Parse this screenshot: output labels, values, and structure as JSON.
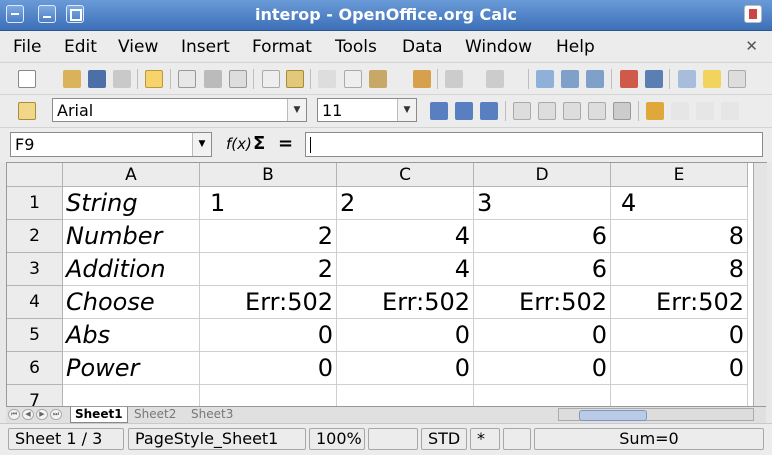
{
  "window": {
    "title": "interop - OpenOffice.org Calc"
  },
  "menu": [
    "File",
    "Edit",
    "View",
    "Insert",
    "Format",
    "Tools",
    "Data",
    "Window",
    "Help"
  ],
  "format_toolbar": {
    "font_name": "Arial",
    "font_size": "11"
  },
  "formula_bar": {
    "cell_ref": "F9",
    "fx_label": "f(x)",
    "sum_label": "Σ",
    "equals_label": "=",
    "content": ""
  },
  "columns": [
    "A",
    "B",
    "C",
    "D",
    "E"
  ],
  "rows": [
    {
      "num": "1",
      "cells": [
        "String",
        "1",
        "2",
        "3",
        "4"
      ]
    },
    {
      "num": "2",
      "cells": [
        "Number",
        "2",
        "4",
        "6",
        "8"
      ]
    },
    {
      "num": "3",
      "cells": [
        "Addition",
        "2",
        "4",
        "6",
        "8"
      ]
    },
    {
      "num": "4",
      "cells": [
        "Choose",
        "Err:502",
        "Err:502",
        "Err:502",
        "Err:502"
      ]
    },
    {
      "num": "5",
      "cells": [
        "Abs",
        "0",
        "0",
        "0",
        "0"
      ]
    },
    {
      "num": "6",
      "cells": [
        "Power",
        "0",
        "0",
        "0",
        "0"
      ]
    },
    {
      "num": "7",
      "cells": [
        "",
        "",
        "",
        "",
        ""
      ]
    }
  ],
  "sheets": [
    "Sheet1",
    "Sheet2",
    "Sheet3"
  ],
  "active_sheet": "Sheet1",
  "status": {
    "sheet": "Sheet 1 / 3",
    "page_style": "PageStyle_Sheet1",
    "zoom": "100%",
    "mode": "STD",
    "modified": "*",
    "sum": "Sum=0"
  },
  "colors": {
    "titlebar": "#4a7dc2",
    "selected_tool": "#f6d36b"
  }
}
